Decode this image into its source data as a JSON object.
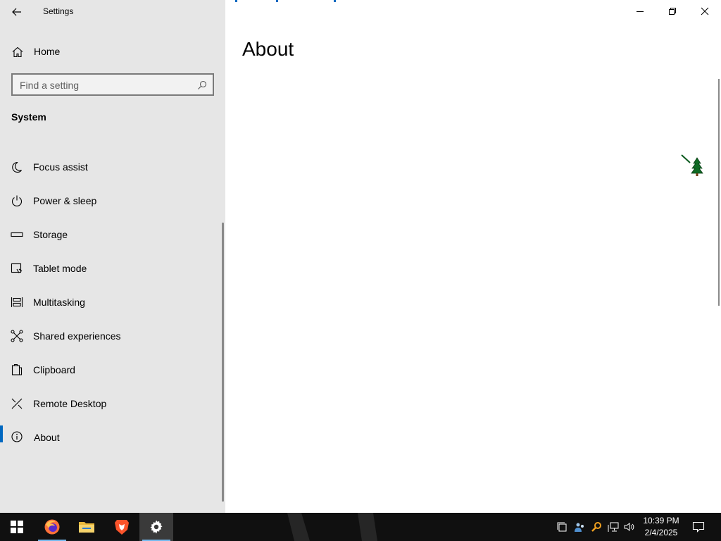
{
  "window": {
    "app_title": "Settings",
    "page_title": "About"
  },
  "sidebar": {
    "home_label": "Home",
    "search_placeholder": "Find a setting",
    "section_title": "System",
    "items": [
      {
        "label": "Focus assist",
        "icon": "moon-icon",
        "selected": false
      },
      {
        "label": "Power & sleep",
        "icon": "power-icon",
        "selected": false
      },
      {
        "label": "Storage",
        "icon": "storage-icon",
        "selected": false
      },
      {
        "label": "Tablet mode",
        "icon": "tablet-mode-icon",
        "selected": false
      },
      {
        "label": "Multitasking",
        "icon": "multitasking-icon",
        "selected": false
      },
      {
        "label": "Shared experiences",
        "icon": "shared-experiences-icon",
        "selected": false
      },
      {
        "label": "Clipboard",
        "icon": "clipboard-icon",
        "selected": false
      },
      {
        "label": "Remote Desktop",
        "icon": "remote-desktop-icon",
        "selected": false
      },
      {
        "label": "About",
        "icon": "info-icon",
        "selected": true
      }
    ]
  },
  "taskbar": {
    "apps": [
      {
        "name": "Windows Start",
        "icon": "windows-start-icon"
      },
      {
        "name": "Firefox",
        "icon": "firefox-icon"
      },
      {
        "name": "File Explorer",
        "icon": "file-explorer-icon"
      },
      {
        "name": "Brave",
        "icon": "brave-icon"
      },
      {
        "name": "Settings",
        "icon": "settings-gear-icon"
      }
    ],
    "clock_time": "10:39 PM",
    "clock_date": "2/4/2025"
  },
  "colors": {
    "accent": "#0067c0",
    "sidebar_bg": "#e6e6e6",
    "taskbar_bg": "#101010"
  }
}
